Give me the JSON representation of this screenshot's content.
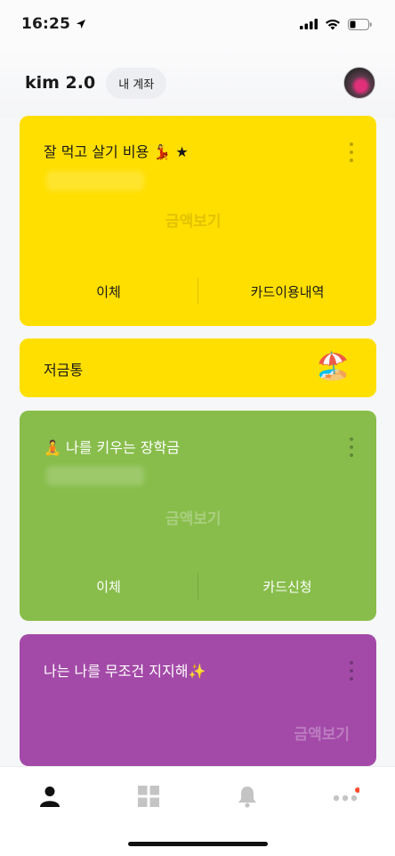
{
  "status_bar": {
    "time": "16:25"
  },
  "header": {
    "title": "kim 2.0",
    "account_label": "내 계좌"
  },
  "cards": {
    "living": {
      "title": "잘 먹고 살기 비용 💃 ★",
      "view_amount": "금액보기",
      "action_left": "이체",
      "action_right": "카드이용내역"
    },
    "piggy": {
      "title": "저금통",
      "emoji": "🏖️"
    },
    "scholarship": {
      "title": "🧘 나를 키우는 장학금",
      "view_amount": "금액보기",
      "action_left": "이체",
      "action_right": "카드신청"
    },
    "support": {
      "title": "나는 나를 무조건 지지해✨",
      "view_amount": "금액보기"
    }
  },
  "colors": {
    "yellow": "#ffdf00",
    "green": "#88bd4b",
    "purple": "#a34aa8"
  },
  "nav": {
    "items": [
      "person-icon",
      "grid-icon",
      "bell-icon",
      "more-icon"
    ]
  }
}
